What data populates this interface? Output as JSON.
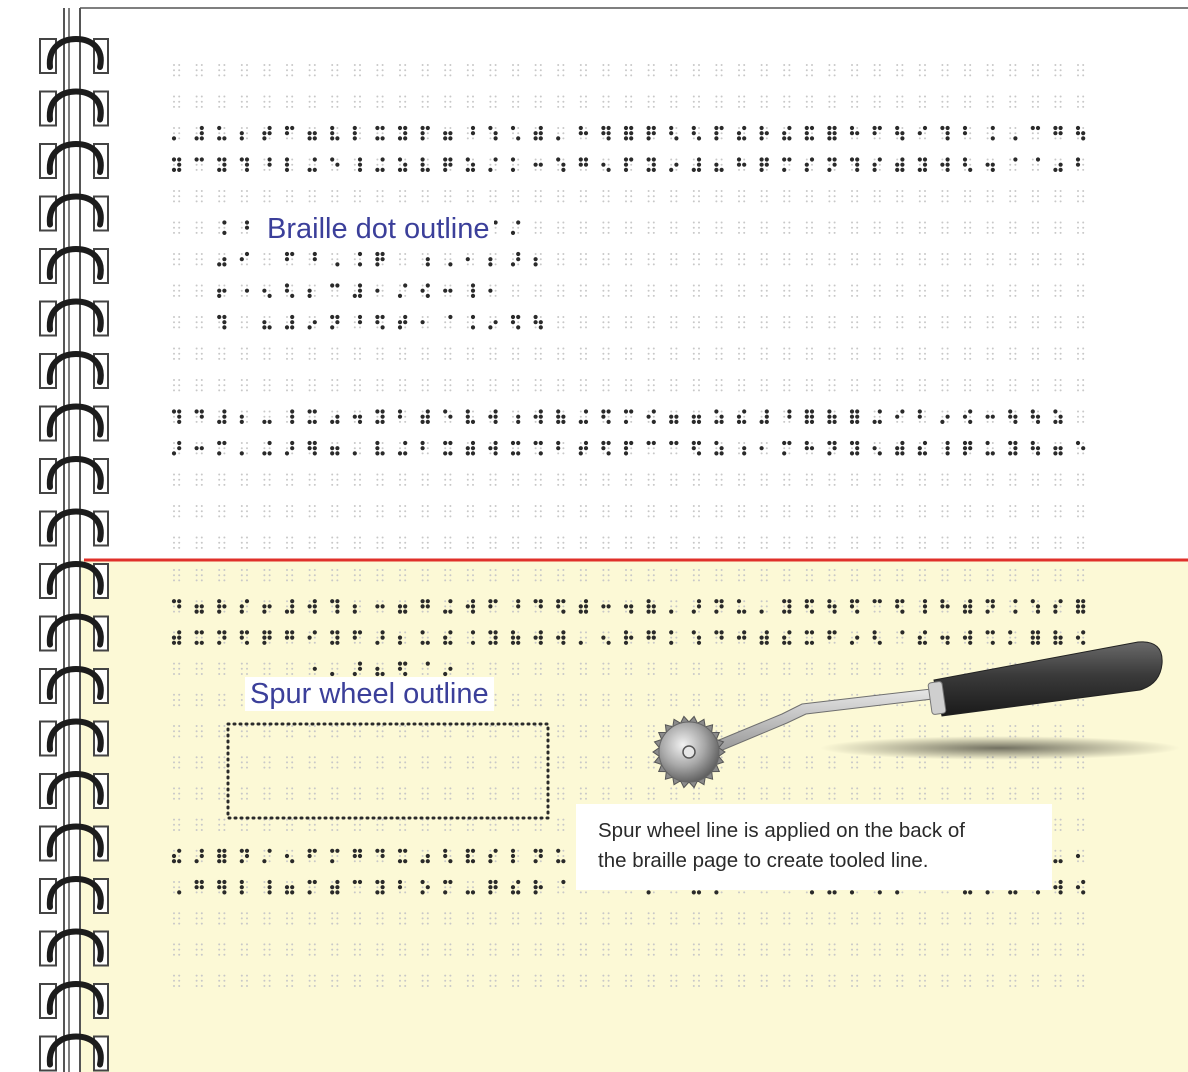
{
  "labels": {
    "braille_outline": "Braille dot outline",
    "spur_outline": "Spur wheel outline",
    "caption_line1": "Spur wheel line is applied on the back of",
    "caption_line2": "the braille page to create tooled line."
  },
  "colors": {
    "page_top": "#ffffff",
    "page_bottom": "#fcf9d6",
    "divider_line": "#e0302a",
    "label_text": "#3b3f9a",
    "dot_light": "#c8c8c8",
    "dot_raised": "#2a2a2a",
    "binding_ring": "#1c1c1c",
    "tool_handle": "#3a3a3a",
    "tool_wheel": "#9a9a9a"
  },
  "icons": {
    "binding": "spiral-binding-rings",
    "tool": "spur-wheel-tool"
  }
}
